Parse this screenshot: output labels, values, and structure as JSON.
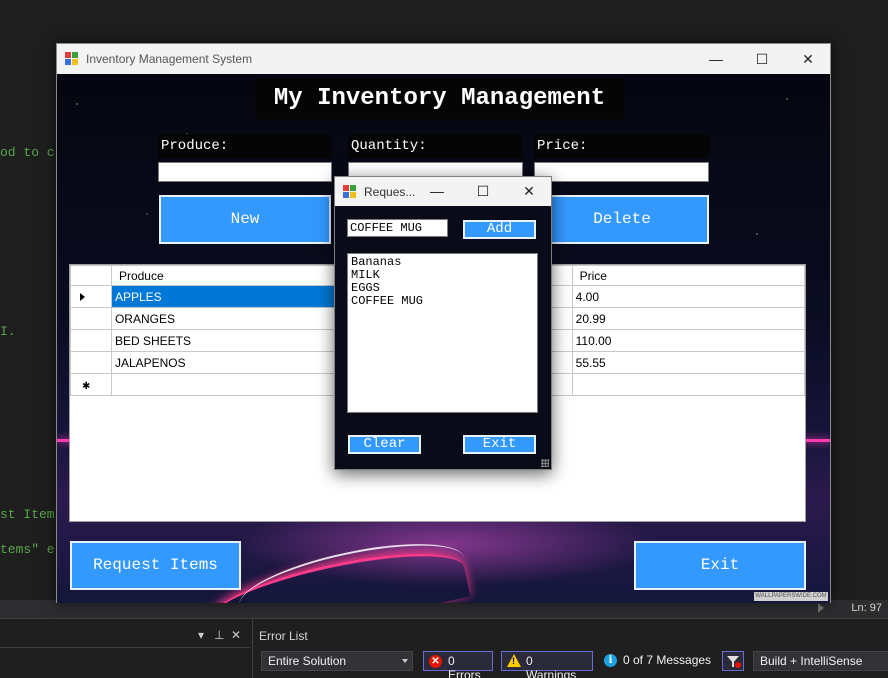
{
  "ide": {
    "code_fragments": [
      "od to c",
      "I.",
      "st Item",
      "tems\" e"
    ],
    "line_indicator": "Ln: 97",
    "error_list": {
      "title": "Error List",
      "scope": "Entire Solution",
      "errors": "0 Errors",
      "warnings": "0 Warnings",
      "messages": "0 of 7 Messages",
      "build_filter": "Build + IntelliSense"
    }
  },
  "main_window": {
    "title": "Inventory Management System",
    "header": "My Inventory Management",
    "labels": {
      "produce": "Produce:",
      "quantity": "Quantity:",
      "price": "Price:"
    },
    "inputs": {
      "produce": "",
      "quantity": "",
      "price": ""
    },
    "buttons": {
      "new": "New",
      "delete": "Delete",
      "request_items": "Request Items",
      "exit": "Exit"
    },
    "grid": {
      "columns": [
        "Produce",
        "",
        "Price"
      ],
      "rows": [
        {
          "produce": "APPLES",
          "price": "4.00",
          "selected": true
        },
        {
          "produce": "ORANGES",
          "price": "20.99",
          "selected": false
        },
        {
          "produce": "BED SHEETS",
          "price": "110.00",
          "selected": false
        },
        {
          "produce": "JALAPENOS",
          "price": "55.55",
          "selected": false
        }
      ]
    },
    "watermark": "WALLPAPERSWIDE.COM"
  },
  "request_dialog": {
    "title": "Reques...",
    "input_value": "COFFEE MUG",
    "buttons": {
      "add": "Add",
      "clear": "Clear",
      "exit": "Exit"
    },
    "list_items": [
      "Bananas",
      "MILK",
      "EGGS",
      "COFFEE MUG"
    ]
  },
  "colors": {
    "button_blue": "#3399ff",
    "selection_blue": "#0078d7",
    "neon_pink": "#ff3bb0"
  }
}
